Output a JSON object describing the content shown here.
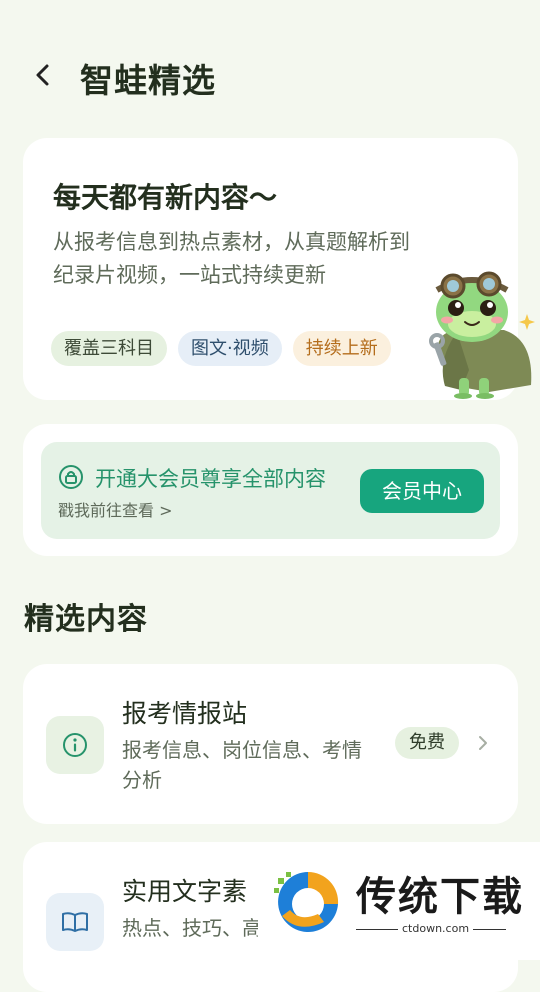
{
  "header": {
    "title": "智蛙精选",
    "back_icon": "chevron-left-icon"
  },
  "intro": {
    "title": "每天都有新内容～",
    "description": "从报考信息到热点素材，从真题解析到纪录片视频，一站式持续更新",
    "tags": [
      "覆盖三科目",
      "图文·视频",
      "持续上新"
    ],
    "mascot": "frog-mascot"
  },
  "vip": {
    "title": "开通大会员尊享全部内容",
    "subtitle": "戳我前往查看 >",
    "button": "会员中心",
    "icon": "lock-icon"
  },
  "section": {
    "title": "精选内容"
  },
  "items": [
    {
      "title": "报考情报站",
      "description": "报考信息、岗位信息、考情分析",
      "badge": "免费",
      "icon": "info-icon"
    },
    {
      "title": "实用文字素",
      "description": "热点、技巧、高…能用能背",
      "icon": "book-icon"
    }
  ],
  "watermark": {
    "brand": "传统下载",
    "url": "ctdown.com"
  },
  "colors": {
    "background": "#f4f8ef",
    "accent": "#17a57e",
    "vip_text": "#26936b",
    "tag_orange": "#b46d1c"
  }
}
